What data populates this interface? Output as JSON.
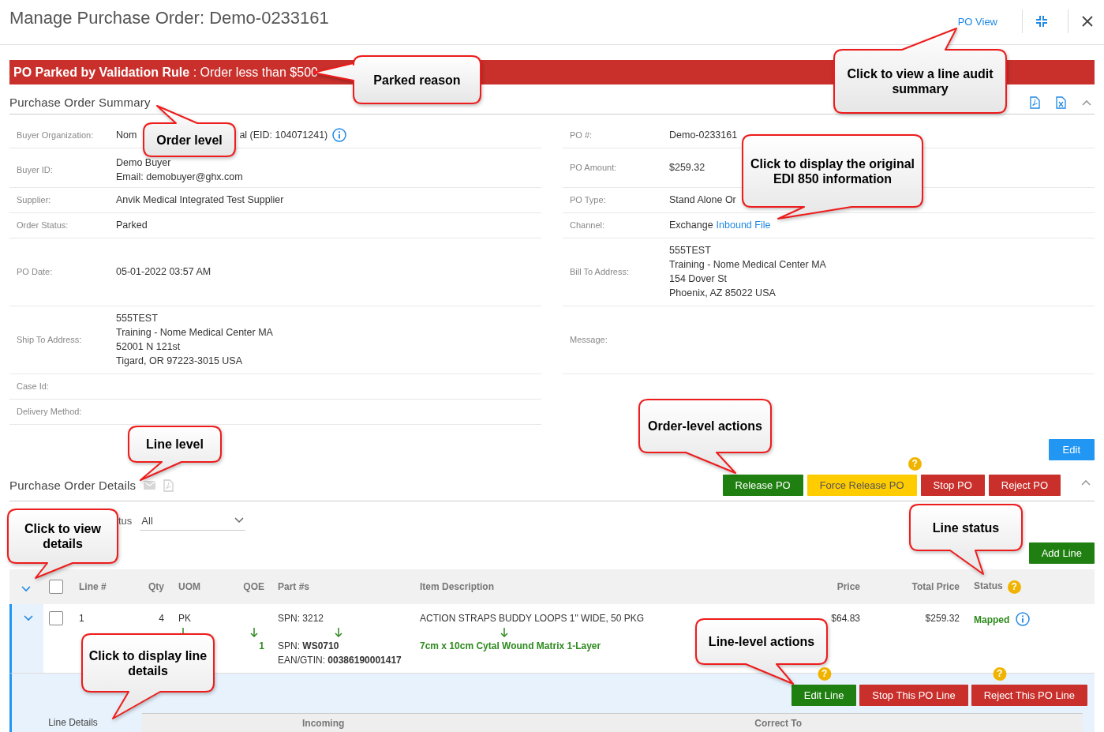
{
  "header": {
    "title": "Manage Purchase Order: Demo-0233161",
    "view_link": "PO View"
  },
  "banner": {
    "text": "**PO Parked by Validation Rule** : Order less than $500"
  },
  "summary": {
    "title": "Purchase Order Summary",
    "expanded": true,
    "rows": [
      {
        "left": {
          "label": "Buyer Organization:",
          "kind": "covered",
          "lines": [
            "Nom",
            "al (EID: 104071241)"
          ],
          "info": true
        },
        "right": {
          "label": "PO #:",
          "kind": "text",
          "lines": [
            "Demo-0233161"
          ]
        }
      },
      {
        "left": {
          "label": "Buyer ID:",
          "kind": "text",
          "lines": [
            "Demo Buyer",
            "Email: demobuyer@ghx.com"
          ]
        },
        "right": {
          "label": "PO Amount:",
          "kind": "text",
          "lines": [
            "$259.32"
          ]
        }
      },
      {
        "left": {
          "label": "Supplier:",
          "kind": "text",
          "lines": [
            "Anvik Medical Integrated Test Supplier"
          ]
        },
        "right": {
          "label": "PO Type:",
          "kind": "text",
          "lines": [
            "Stand Alone Or"
          ]
        }
      },
      {
        "left": {
          "label": "Order Status:",
          "kind": "text",
          "lines": [
            "Parked"
          ]
        },
        "right": {
          "label": "Channel:",
          "kind": "link",
          "lines": [
            "Exchange"
          ],
          "link": "Inbound File"
        }
      },
      {
        "left": {
          "label": "PO Date:",
          "kind": "text",
          "lines": [
            "05-01-2022 03:57 AM"
          ]
        },
        "right": {
          "label": "Bill To Address:",
          "kind": "text",
          "lines": [
            "555TEST",
            "Training - Nome Medical Center MA",
            "154 Dover St",
            "Phoenix, AZ 85022 USA"
          ]
        }
      },
      {
        "left": {
          "label": "Ship To Address:",
          "kind": "text",
          "lines": [
            "555TEST",
            "Training - Nome Medical Center MA",
            "52001 N 121st",
            "Tigard, OR 97223-3015 USA"
          ]
        },
        "right": {
          "label": "Message:",
          "kind": "text"
        }
      },
      {
        "left": {
          "label": "Case Id:",
          "kind": "text"
        }
      },
      {
        "left": {
          "label": "Delivery Method:",
          "kind": "text"
        }
      }
    ]
  },
  "details": {
    "title": "Purchase Order Details",
    "expanded": true,
    "edit_button": "Edit",
    "actions": [
      {
        "label": "Release PO",
        "kind": "release"
      },
      {
        "label": "Force Release PO",
        "kind": "force",
        "help": "?"
      },
      {
        "label": "Stop PO",
        "kind": "stop"
      },
      {
        "label": "Reject PO",
        "kind": "reject"
      }
    ],
    "filter": {
      "label": "tus",
      "value": "All"
    },
    "add_line": "Add Line",
    "table": {
      "all_checked": false,
      "columns": [
        "Line #",
        "Qty",
        "UOM",
        "QOE",
        "Part #s",
        "Item Description",
        "Price",
        "Total Price",
        "Status"
      ],
      "status_help": "?",
      "rows": [
        {
          "expanded": true,
          "checked": false,
          "line": "1",
          "qty": "4",
          "uom": "PK",
          "qoe": "1",
          "parts": [
            "SPN: 3212",
            "SPN: **WS0710**",
            "EAN/GTIN: **00386190001417**"
          ],
          "description": "ACTION STRAPS BUDDY LOOPS 1\" WIDE, 50 PKG",
          "mapped_description": "7cm x 10cm Cytal Wound Matrix 1-Layer",
          "price": "$64.83",
          "total": "$259.32",
          "status": "Mapped",
          "actions": [
            {
              "label": "Edit Line",
              "kind": "edit",
              "help": "?"
            },
            {
              "label": "Stop This PO Line",
              "kind": "stop"
            },
            {
              "label": "Reject This PO Line",
              "kind": "reject",
              "help": "?"
            }
          ],
          "details": {
            "label": "Line Details",
            "columns": [
              "Incoming",
              "Correct To"
            ]
          }
        }
      ]
    }
  },
  "callouts": [
    "Parked reason",
    "Click to view a line audit summary",
    "Order level",
    "Click to display the original EDI 850 information",
    "Order-level actions",
    "Line level",
    "Click to view details",
    "Line status",
    "Line-level actions",
    "Click to display line details"
  ]
}
